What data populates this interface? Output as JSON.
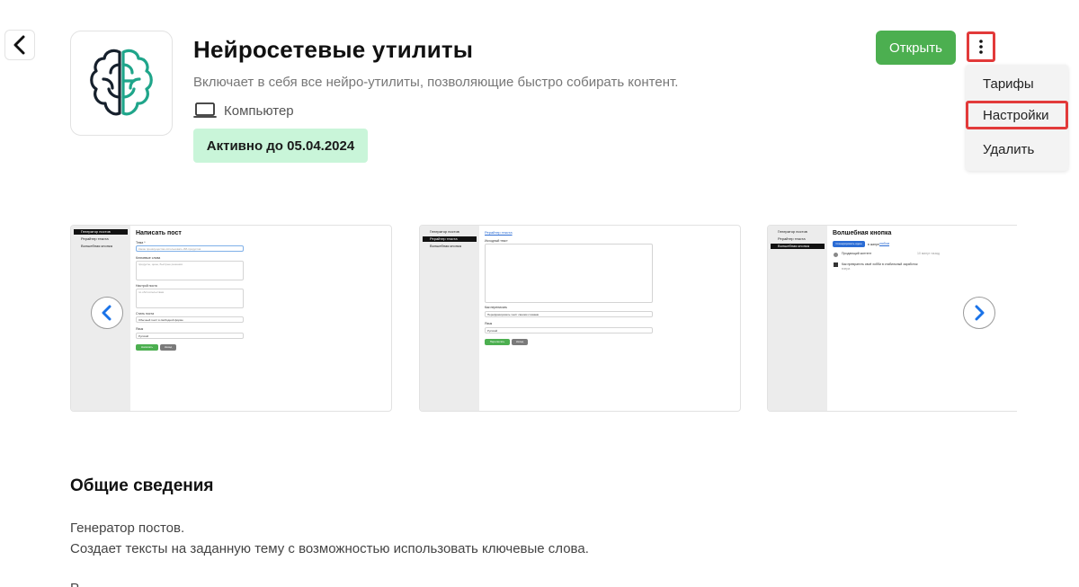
{
  "header": {
    "title": "Нейросетевые утилиты",
    "description": "Включает в себя все нейро-утилиты, позволяющие быстро собирать контент.",
    "platform": "Компьютер",
    "active_badge": "Активно до 05.04.2024",
    "open_label": "Открыть"
  },
  "colors": {
    "accent_green": "#4caf50",
    "badge_bg": "#c9f5d9",
    "highlight_red": "#e23a3a",
    "carousel_blue": "#1a73e8"
  },
  "icons": {
    "back": "chevron-left-icon",
    "more": "more-vertical-icon",
    "app": "brain-icon",
    "platform": "laptop-icon",
    "prev": "chevron-left-icon",
    "next": "chevron-right-icon"
  },
  "menu": {
    "items": [
      {
        "label": "Тарифы"
      },
      {
        "label": "Настройки"
      },
      {
        "label": "Удалить"
      }
    ]
  },
  "screenshots": {
    "sidebar": [
      "Генератор постов",
      "Рерайтер текста",
      "Волшебная кнопка"
    ],
    "shot1": {
      "title": "Написать пост",
      "topic_label": "Тема *",
      "topic_placeholder": "Какие преимущества использовать ИИ-продуктов",
      "keywords_label": "Ключевые слова",
      "keywords_placeholder": "продукты, цены, быстрые решения",
      "mood_label": "Настрой поста",
      "mood_placeholder": "по обстоятельствам",
      "style_label": "Стиль поста",
      "style_value": "Обычный текст в свободной форме",
      "lang_label": "Язык",
      "lang_value": "Русский",
      "primary_btn": "Написать",
      "secondary_btn": "Назад"
    },
    "shot2": {
      "link": "Рерайтер текста",
      "source_label": "Исходный текст",
      "how_label": "Как переписать",
      "how_value": "Перефразировать текст своими словами",
      "lang_label": "Язык",
      "lang_value": "Русский",
      "primary_btn": "Переписать",
      "secondary_btn": "Назад"
    },
    "shot3": {
      "title": "Волшебная кнопка",
      "action_btn": "Сгенерировать идею",
      "action_suffix": "в жанре",
      "action_link": "любом",
      "item1": "Продающий контент",
      "item1_meta": "10 минут назад",
      "item2": "Как превратить своё хобби в стабильный заработок",
      "item2_meta": "вчера"
    }
  },
  "info": {
    "section_title": "Общие сведения",
    "line1": "Генератор постов.",
    "line2": "Создает тексты на заданную тему с возможностью использовать ключевые слова.",
    "line3": "Р"
  }
}
